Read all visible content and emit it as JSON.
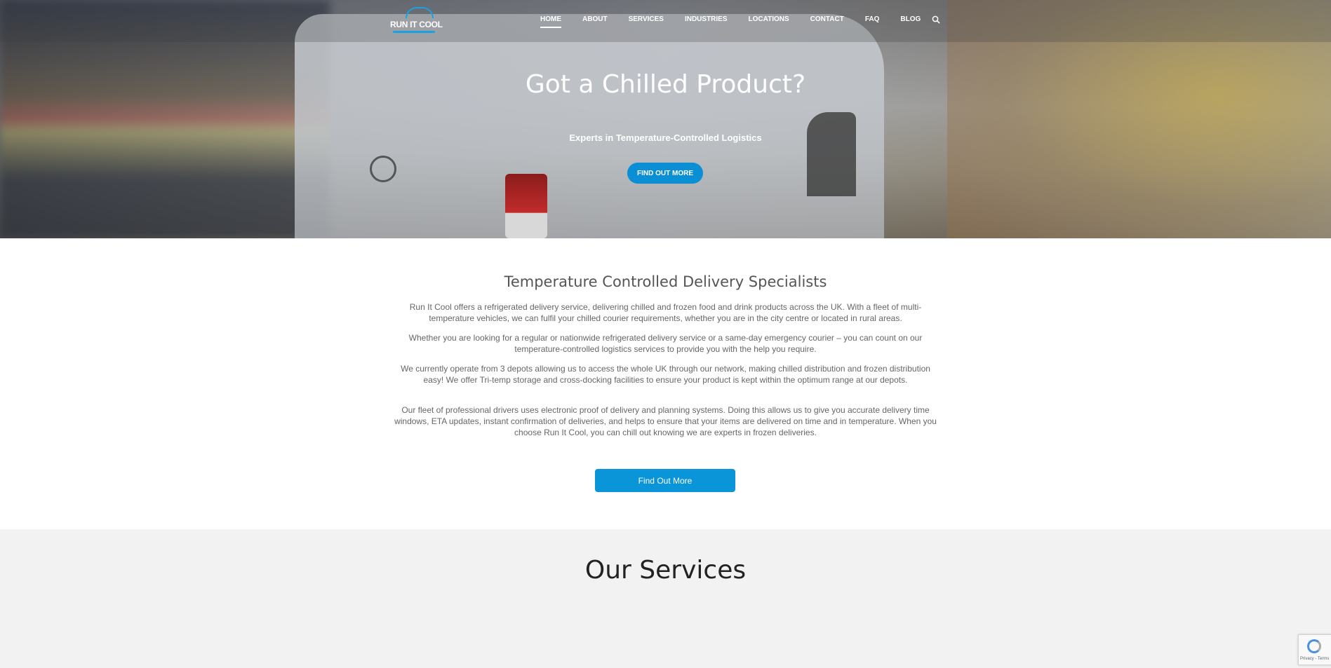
{
  "header": {
    "logo_text": "RUN IT COOL",
    "nav": [
      {
        "label": "HOME"
      },
      {
        "label": "ABOUT"
      },
      {
        "label": "SERVICES"
      },
      {
        "label": "INDUSTRIES"
      },
      {
        "label": "LOCATIONS"
      },
      {
        "label": "CONTACT"
      },
      {
        "label": "FAQ"
      },
      {
        "label": "BLOG"
      }
    ],
    "search_icon": "search-icon"
  },
  "hero": {
    "title": "Got a Chilled Product?",
    "subtitle": "Experts in Temperature-Controlled Logistics",
    "button": "FIND OUT MORE"
  },
  "main": {
    "heading": "Temperature Controlled Delivery Specialists",
    "paragraphs": [
      "Run It Cool offers a refrigerated delivery service, delivering chilled and frozen food and drink products across the UK. With a fleet of multi-temperature vehicles, we can fulfil your chilled courier requirements, whether you are in the city centre or located in rural areas.",
      "Whether you are looking for a regular or nationwide refrigerated delivery service or a same-day emergency courier – you can count on our temperature-controlled logistics services to provide you with the help you require.",
      "We currently operate from 3 depots allowing us to access the whole UK through our network, making chilled distribution and frozen distribution easy! We offer Tri-temp storage and cross-docking facilities to ensure your product is kept within the optimum range at our depots.",
      "Our fleet of professional drivers uses electronic proof of delivery and planning systems. Doing this allows us to give you accurate delivery time windows, ETA updates, instant confirmation of deliveries, and helps to ensure that your items are delivered on time and in temperature. When you choose Run It Cool, you can chill out knowing we are experts in frozen deliveries."
    ],
    "button": "Find Out More"
  },
  "services": {
    "heading": "Our Services"
  },
  "recaptcha": {
    "text": "Privacy - Terms"
  },
  "colors": {
    "accent": "#0a95d8",
    "services_bg": "#f2f2f2"
  }
}
